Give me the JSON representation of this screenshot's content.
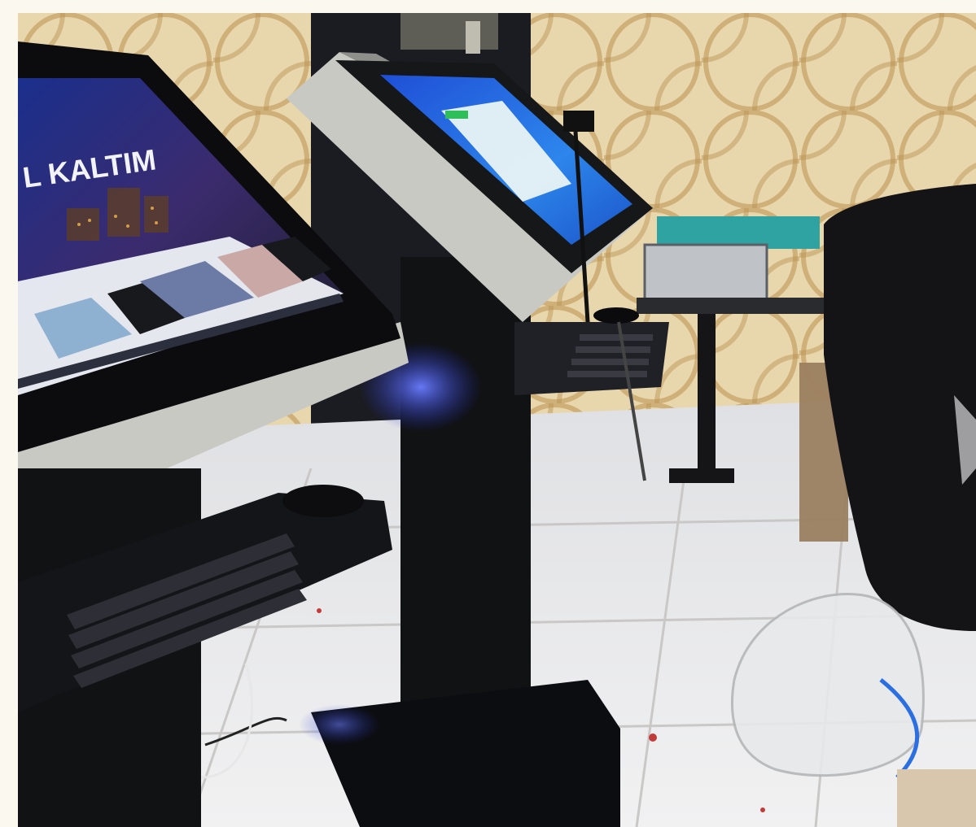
{
  "photo": {
    "screen_left_brand": "L KALTIM",
    "colors": {
      "wall": "#e8d7ad",
      "wall_pattern": "#b9904f",
      "floor": "#e9eaec",
      "tile_line": "#c9c8c6",
      "kiosk_black": "#111214",
      "kiosk_silver": "#c9c9c4",
      "screen_blue": "#2f72d8",
      "glow_blue": "#3f5dff",
      "teal_case": "#2fa3a2"
    }
  }
}
